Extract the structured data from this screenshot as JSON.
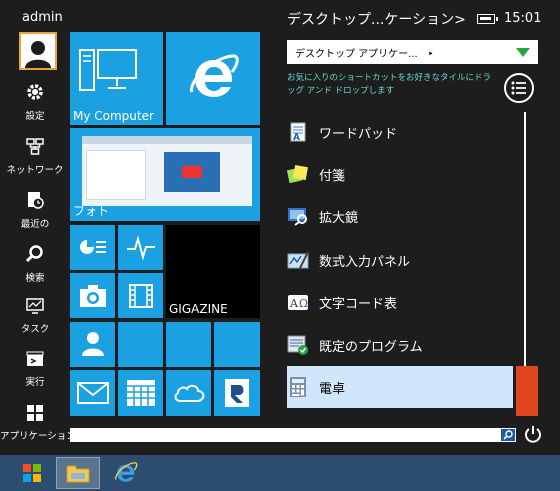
{
  "user": {
    "name": "admin"
  },
  "rail": [
    {
      "label": "設定",
      "icon": "gear-icon"
    },
    {
      "label": "ネットワーク",
      "icon": "network-icon"
    },
    {
      "label": "最近の",
      "icon": "recent-icon"
    },
    {
      "label": "検索",
      "icon": "search-icon"
    },
    {
      "label": "タスク",
      "icon": "task-icon"
    },
    {
      "label": "実行",
      "icon": "run-icon"
    },
    {
      "label": "アプリケーション",
      "icon": "apps-icon"
    }
  ],
  "tiles": {
    "my_computer": "My Computer",
    "photos": "フォト",
    "gigazine": "GIGAZINE"
  },
  "panel": {
    "title": "デスクトップ...ケーション>",
    "clock": "15:01",
    "dropdown_value": "デスクトップ アプリケー...　‣",
    "hint": "お気に入りのショートカットをお好きなタイルにドラッグ アンド ドロップします"
  },
  "apps": [
    {
      "label": "ワードパッド",
      "icon": "wordpad-icon"
    },
    {
      "label": "付箋",
      "icon": "sticky-notes-icon"
    },
    {
      "label": "拡大鏡",
      "icon": "magnifier-icon"
    },
    {
      "label": "数式入力パネル",
      "icon": "math-input-icon"
    },
    {
      "label": "文字コード表",
      "icon": "character-map-icon"
    },
    {
      "label": "既定のプログラム",
      "icon": "default-programs-icon"
    },
    {
      "label": "電卓",
      "icon": "calculator-icon"
    }
  ],
  "colors": {
    "tile_blue": "#1ba1e2",
    "hint_text": "#66d9c8",
    "scroll_thumb": "#e1471f",
    "taskbar": "#2c4c70",
    "selected_item": "#cfe6fb"
  }
}
